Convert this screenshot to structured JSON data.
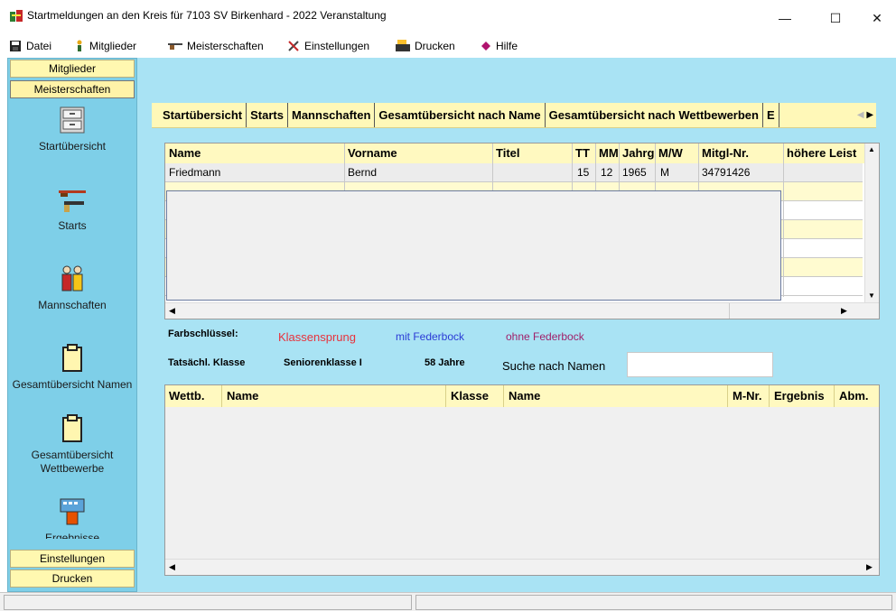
{
  "window": {
    "title": "Startmeldungen an den Kreis für 7103 SV Birkenhard - 2022   Veranstaltung",
    "minimize": "—",
    "maximize": "☐",
    "close": "✕"
  },
  "menu": [
    {
      "label": "Datei",
      "icon": "save-icon"
    },
    {
      "label": "Mitglieder",
      "icon": "person-icon"
    },
    {
      "label": "Meisterschaften",
      "icon": "rifle-icon"
    },
    {
      "label": "Einstellungen",
      "icon": "tools-icon"
    },
    {
      "label": "Drucken",
      "icon": "printer-icon"
    },
    {
      "label": "Hilfe",
      "icon": "help-icon"
    }
  ],
  "nav": {
    "top_buttons": [
      "Mitglieder",
      "Meisterschaften"
    ],
    "items": [
      {
        "label": "Startübersicht",
        "icon": "cabinet-icon"
      },
      {
        "label": "Starts",
        "icon": "guns-icon"
      },
      {
        "label": "Mannschaften",
        "icon": "team-icon"
      },
      {
        "label": "Gesamtübersicht Namen",
        "icon": "clipboard-icon"
      },
      {
        "label": "Gesamtübersicht Wettbewerbe",
        "icon": "clipboard-icon"
      },
      {
        "label": "Ergebnisse",
        "icon": "keyboard-icon"
      }
    ],
    "bottom_buttons": [
      "Einstellungen",
      "Drucken"
    ]
  },
  "tabs": [
    "Startübersicht",
    "Starts",
    "Mannschaften",
    "Gesamtübersicht nach Name",
    "Gesamtübersicht nach Wettbewerben",
    "E"
  ],
  "grid1": {
    "columns": [
      "Name",
      "Vorname",
      "Titel",
      "TT",
      "MM",
      "Jahrg",
      "M/W",
      "Mitgl-Nr.",
      "höhere Leist"
    ],
    "rows": [
      [
        "Friedmann",
        "Bernd",
        "",
        "15",
        "12",
        "1965",
        "M",
        "34791426",
        ""
      ]
    ]
  },
  "legend": {
    "label": "Farbschlüssel:",
    "klassensprung": "Klassensprung",
    "mit_federbock": "mit Federbock",
    "ohne_federbock": "ohne Federbock",
    "colors": {
      "klassensprung": "#e8323c",
      "mit_federbock": "#2a3bd6",
      "ohne_federbock": "#a0206a"
    }
  },
  "klasse": {
    "label": "Tatsächl. Klasse",
    "value": "Seniorenklasse I",
    "age": "58 Jahre"
  },
  "search": {
    "label": "Suche nach Namen",
    "value": ""
  },
  "grid2": {
    "columns": [
      "Wettb.",
      "Name",
      "Klasse",
      "Name",
      "M-Nr.",
      "Ergebnis",
      "Abm."
    ]
  }
}
